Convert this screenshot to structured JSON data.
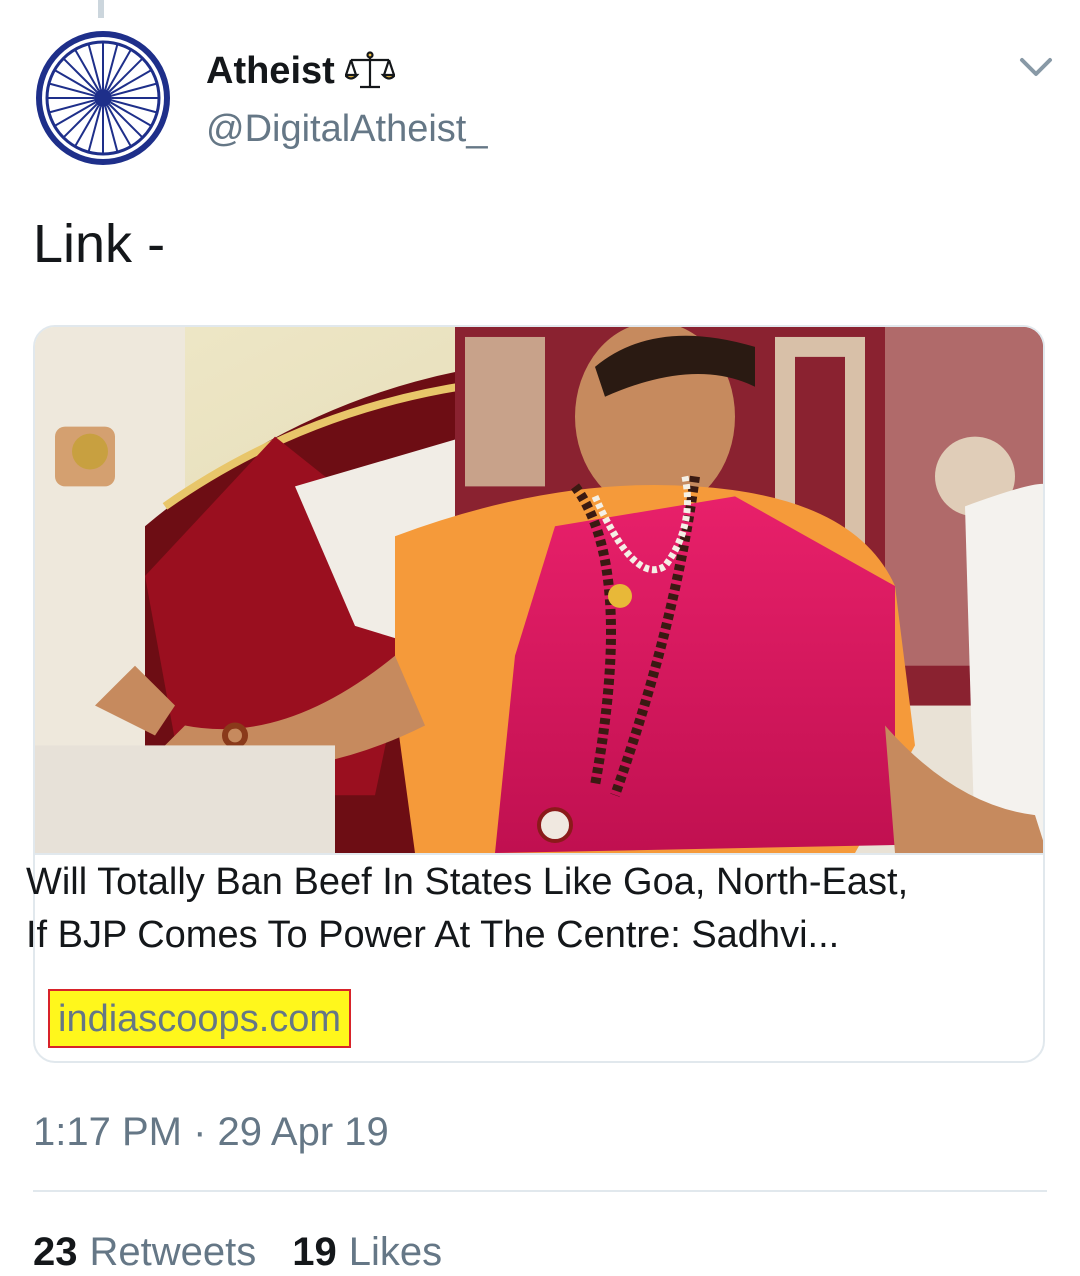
{
  "tweet": {
    "display_name": "Atheist",
    "verified_icon": "scales-icon",
    "handle": "@DigitalAtheist_",
    "text": "Link -",
    "avatar_icon": "ashoka-chakra-icon",
    "menu_icon": "chevron-down-icon"
  },
  "card": {
    "image_description_icon": "news-photo",
    "title_line_1": "Will Totally Ban Beef In States Like Goa, North-East,",
    "title_line_2": "If BJP Comes To Power At The Centre: Sadhvi...",
    "domain": "indiascoops.com",
    "highlight_color": "#fff71c",
    "highlight_border_color": "#d8232a"
  },
  "meta": {
    "timestamp": "1:17 PM · 29 Apr 19"
  },
  "stats": {
    "retweets_count": "23",
    "retweets_label": "Retweets",
    "likes_count": "19",
    "likes_label": "Likes"
  },
  "colors": {
    "text_primary": "#14171a",
    "text_secondary": "#657786",
    "border": "#e1e8ed",
    "chakra_blue": "#000080"
  }
}
